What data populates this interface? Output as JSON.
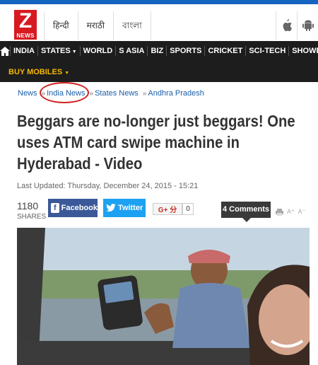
{
  "logo": {
    "letter": "Z",
    "text": "NEWS"
  },
  "languages": [
    "हिन्दी",
    "मराठी",
    "বাংলা"
  ],
  "nav": {
    "items": [
      {
        "label": "INDIA",
        "dropdown": false
      },
      {
        "label": "STATES",
        "dropdown": true
      },
      {
        "label": "WORLD",
        "dropdown": false
      },
      {
        "label": "S ASIA",
        "dropdown": false
      },
      {
        "label": "BIZ",
        "dropdown": false
      },
      {
        "label": "SPORTS",
        "dropdown": false
      },
      {
        "label": "CRICKET",
        "dropdown": false
      },
      {
        "label": "SCI-TECH",
        "dropdown": false
      },
      {
        "label": "SHOWBIZ",
        "dropdown": false
      }
    ],
    "buy_mobiles": "BUY MOBILES"
  },
  "breadcrumb": [
    "News",
    "India News",
    "States News",
    "Andhra Pradesh"
  ],
  "article": {
    "headline": "Beggars are no-longer just beggars! One uses ATM card swipe machine in Hyderabad - Video",
    "updated": "Last Updated: Thursday, December 24, 2015 - 15:21"
  },
  "share": {
    "count": "1180",
    "label": "SHARES",
    "facebook": "Facebook",
    "twitter": "Twitter",
    "gplus": "G+ 分",
    "gplus_count": "0",
    "comments": "4 Comments"
  },
  "colors": {
    "brand_red": "#d71920",
    "nav_bg": "#1d1d1d",
    "buy_mobiles": "#f5b800",
    "link": "#1a5fa8",
    "facebook": "#3b5998",
    "twitter": "#1da1f2",
    "highlight_circle": "#d32020"
  }
}
